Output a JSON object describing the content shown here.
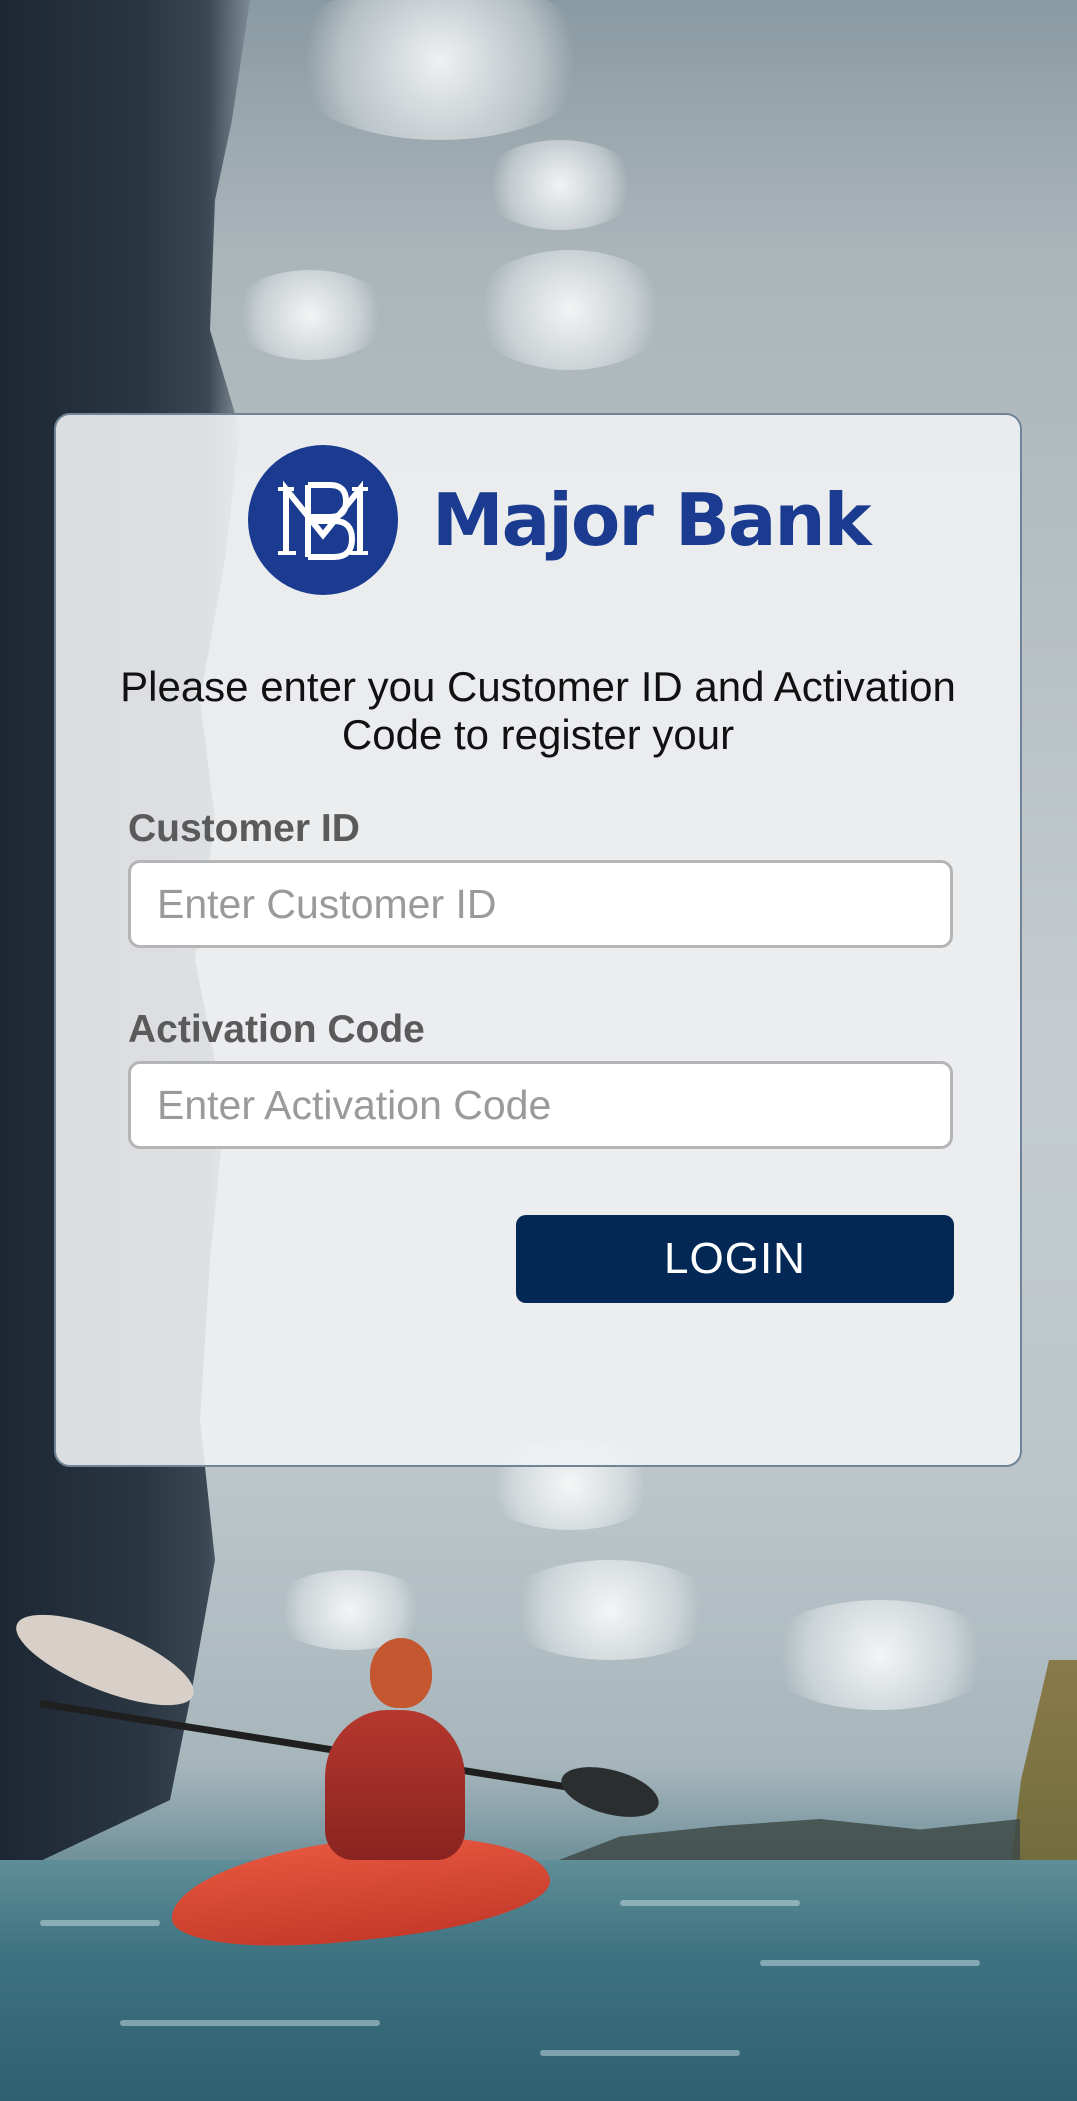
{
  "brand": {
    "name": "Major Bank",
    "logo_monogram": "MB",
    "logo_icon": "mb-monogram-logo",
    "color": "#1a3b8f"
  },
  "form": {
    "instructions": "Please enter you Customer ID and Activation Code to register your",
    "customer_id": {
      "label": "Customer ID",
      "value": "",
      "placeholder": "Enter Customer ID"
    },
    "activation_code": {
      "label": "Activation Code",
      "value": "",
      "placeholder": "Enter Activation Code"
    },
    "login_label": "LOGIN",
    "login_color": "#042856"
  },
  "background": {
    "scene": "kayaker-on-water-background"
  }
}
